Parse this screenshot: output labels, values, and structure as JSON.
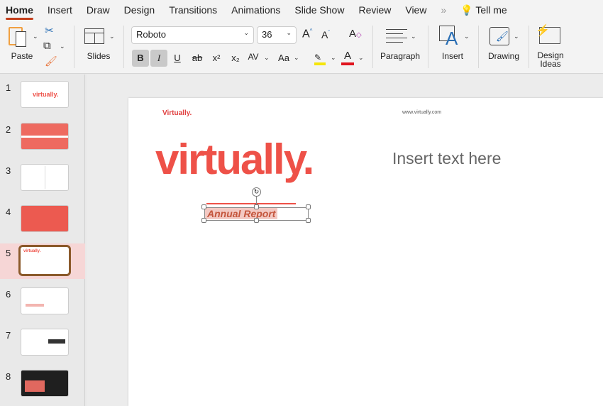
{
  "tabs": [
    "Home",
    "Insert",
    "Draw",
    "Design",
    "Transitions",
    "Animations",
    "Slide Show",
    "Review",
    "View"
  ],
  "tell_me": "Tell me",
  "ribbon": {
    "paste": "Paste",
    "slides": "Slides",
    "font": "Roboto",
    "size": "36",
    "bold": "B",
    "italic": "I",
    "underline": "U",
    "strike": "ab",
    "superscript": "x²",
    "subscript": "x₂",
    "spacing": "AV",
    "case": "Aa",
    "grow": "A",
    "shrink": "A",
    "paragraph": "Paragraph",
    "insert": "Insert",
    "drawing": "Drawing",
    "design_ideas_1": "Design",
    "design_ideas_2": "Ideas",
    "highlight_color": "#f5e50a",
    "font_color": "#e0141e"
  },
  "slides": [
    "1",
    "2",
    "3",
    "4",
    "5",
    "6",
    "7",
    "8"
  ],
  "thumb1_text": "virtually.",
  "slide": {
    "brand": "Virtually.",
    "url": "www.virtually.com",
    "logo": "virtually.",
    "placeholder": "Insert text here",
    "subtitle": "Annual Report",
    "accent": "#ee5148"
  }
}
